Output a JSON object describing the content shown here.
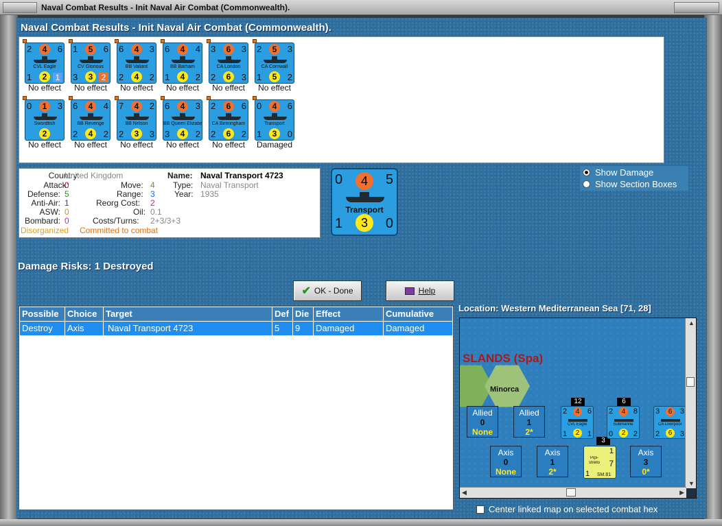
{
  "window": {
    "title": "Naval Combat Results - Init Naval Air Combat (Commonwealth)."
  },
  "heading": "Naval Combat Results - Init Naval Air Combat (Commonwealth).",
  "units": [
    {
      "name": "CVL Eagle",
      "tl": "2",
      "top": "4",
      "tr": "6",
      "bl": "1",
      "bot": "2",
      "br": "1",
      "br_style": "blue",
      "effect": "No effect"
    },
    {
      "name": "CV Glorious",
      "tl": "1",
      "top": "5",
      "tr": "6",
      "bl": "3",
      "bot": "3",
      "br": "2",
      "br_style": "orange",
      "effect": "No effect"
    },
    {
      "name": "BB Valiant",
      "tl": "6",
      "top": "4",
      "tr": "3",
      "bl": "2",
      "bot": "4",
      "br": "2",
      "br_style": "",
      "effect": "No effect"
    },
    {
      "name": "BB Barham",
      "tl": "6",
      "top": "4",
      "tr": "4",
      "bl": "1",
      "bot": "4",
      "br": "2",
      "br_style": "",
      "effect": "No effect"
    },
    {
      "name": "CA London",
      "tl": "3",
      "top": "6",
      "tr": "3",
      "bl": "2",
      "bot": "6",
      "br": "3",
      "br_style": "",
      "effect": "No effect"
    },
    {
      "name": "CA Cornwall",
      "tl": "2",
      "top": "5",
      "tr": "3",
      "bl": "1",
      "bot": "5",
      "br": "2",
      "br_style": "",
      "effect": "No effect"
    },
    {
      "name": "Swordfish",
      "tl": "0",
      "top": "1",
      "tr": "3",
      "bl": "",
      "bot": "2",
      "br": "",
      "br_style": "",
      "effect": "No effect"
    },
    {
      "name": "BB Revenge",
      "tl": "6",
      "top": "4",
      "tr": "4",
      "bl": "2",
      "bot": "4",
      "br": "2",
      "br_style": "",
      "effect": "No effect"
    },
    {
      "name": "BB Nelson",
      "tl": "7",
      "top": "4",
      "tr": "2",
      "bl": "2",
      "bot": "3",
      "br": "3",
      "br_style": "",
      "effect": "No effect"
    },
    {
      "name": "BB Queen Elizabeth",
      "tl": "6",
      "top": "4",
      "tr": "3",
      "bl": "3",
      "bot": "4",
      "br": "2",
      "br_style": "",
      "effect": "No effect"
    },
    {
      "name": "CA Birmingham",
      "tl": "2",
      "top": "6",
      "tr": "6",
      "bl": "2",
      "bot": "6",
      "br": "2",
      "br_style": "",
      "effect": "No effect"
    },
    {
      "name": "Transport",
      "tl": "0",
      "top": "4",
      "tr": "6",
      "bl": "1",
      "bot": "3",
      "br": "0",
      "br_style": "",
      "effect": "Damaged"
    }
  ],
  "info": {
    "country_label": "Country:",
    "country": "United Kingdom",
    "attack_label": "Attack:",
    "attack": "0",
    "defense_label": "Defense:",
    "defense": "5",
    "antiair_label": "Anti-Air:",
    "antiair": "1",
    "asw_label": "ASW:",
    "asw": "0",
    "bombard_label": "Bombard:",
    "bombard": "0",
    "name_label": "Name:",
    "name": "Naval Transport 4723",
    "type_label": "Type:",
    "type": "Naval Transport",
    "year_label": "Year:",
    "year": "1935",
    "move_label": "Move:",
    "move": "4",
    "range_label": "Range:",
    "range": "3",
    "reorg_label": "Reorg Cost:",
    "reorg": "2",
    "oil_label": "Oil:",
    "oil": "0.1",
    "costs_label": "Costs/Turns:",
    "costs": "2+3/3+3",
    "status1": "Disorganized",
    "status2": "Committed to combat"
  },
  "big_counter": {
    "tl": "0",
    "top": "4",
    "tr": "5",
    "name": "Transport",
    "bl": "1",
    "bot": "3",
    "br": "0"
  },
  "radio": {
    "opt1": "Show Damage",
    "opt2": "Show Section Boxes"
  },
  "risks": "Damage Risks:  1 Destroyed",
  "buttons": {
    "ok": "OK - Done",
    "help": "Help"
  },
  "table": {
    "headers": [
      "Possible",
      "Choice",
      "Target",
      "Def",
      "Die",
      "Effect",
      "Cumulative"
    ],
    "rows": [
      [
        "Destroy",
        "Axis",
        "Naval Transport 4723",
        "5",
        "9",
        "Damaged",
        "Damaged"
      ]
    ]
  },
  "location": "Location:  Western Mediterranean Sea [71, 28]",
  "map": {
    "islands_label": "SLANDS (Spa)",
    "minorca": "Minorca",
    "allied_boxes": [
      {
        "a": "Allied",
        "b": "0",
        "c": "None"
      },
      {
        "a": "Allied",
        "b": "1",
        "c": "2*"
      }
    ],
    "axis_boxes": [
      {
        "a": "Axis",
        "b": "0",
        "c": "None"
      },
      {
        "a": "Axis",
        "b": "1",
        "c": "2*"
      },
      {
        "a": "Axis",
        "b": "3",
        "c": "0*"
      }
    ],
    "stack1": "12",
    "stack2": "6",
    "stack3": "3",
    "m_units": [
      {
        "name": "CVL Eagle",
        "tl": "2",
        "top": "4",
        "tr": "6",
        "bl": "1",
        "bot": "2",
        "br": "1"
      },
      {
        "name": "Submarine",
        "tl": "2",
        "top": "4",
        "tr": "8",
        "bl": "0",
        "bot": "2",
        "br": "2"
      },
      {
        "name": "CA Liverpool",
        "tl": "3",
        "top": "6",
        "tr": "3",
        "bl": "2",
        "bot": "6",
        "br": "3"
      }
    ],
    "aircraft": {
      "name": "SM.81",
      "line1": "Pipi-",
      "line2": "strello",
      "bl": "1",
      "tr": "1",
      "mid": "7"
    }
  },
  "checkbox": "Center linked map on selected combat hex",
  "colors": {
    "panel": "#2f6f9f",
    "highlight": "#1f8ef0",
    "counter": "#2a9ee0",
    "orange": "#f07030",
    "yellow": "#ffe81a"
  }
}
